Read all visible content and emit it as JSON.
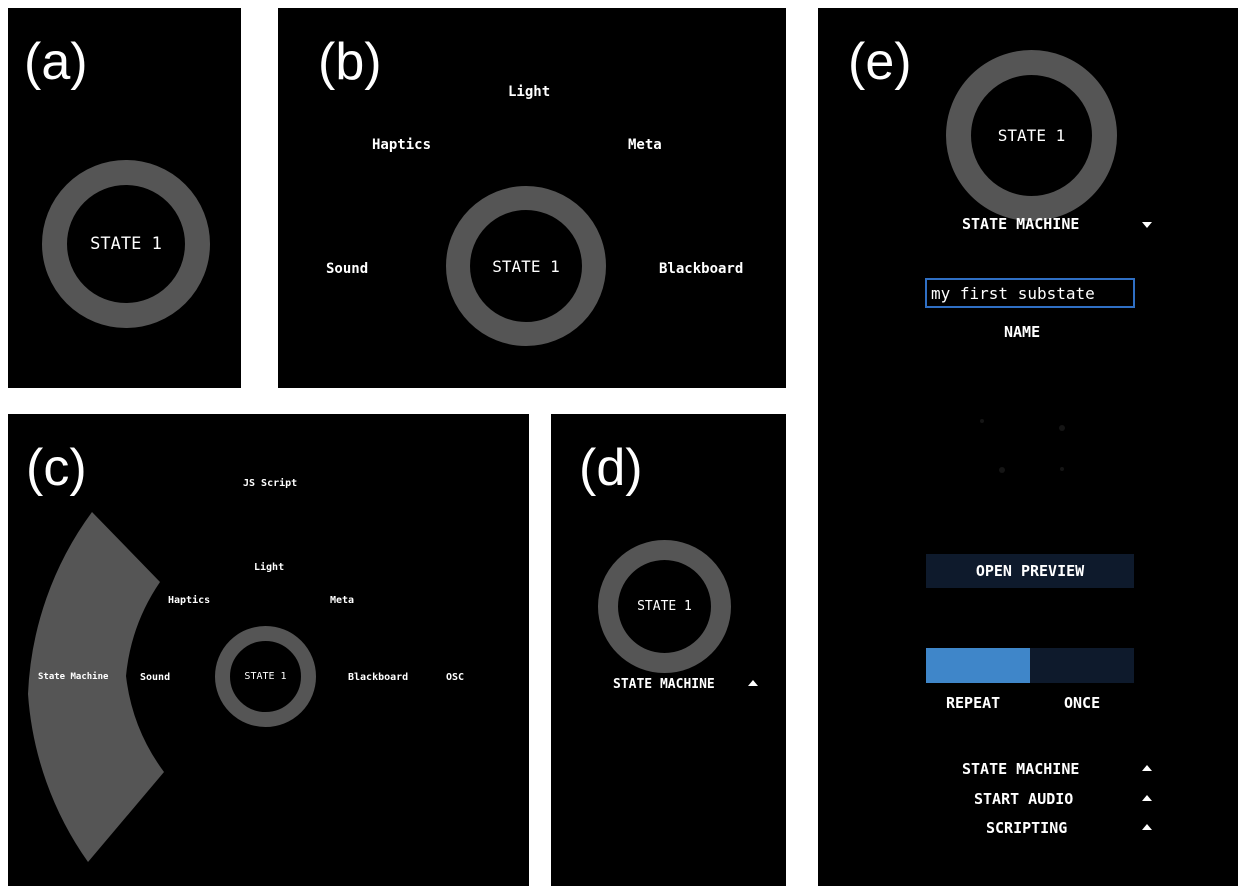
{
  "panels": {
    "a": {
      "label": "(a)",
      "state": "STATE 1"
    },
    "b": {
      "label": "(b)",
      "state": "STATE 1",
      "menu": {
        "light": "Light",
        "haptics": "Haptics",
        "meta": "Meta",
        "sound": "Sound",
        "blackboard": "Blackboard"
      }
    },
    "c": {
      "label": "(c)",
      "state": "STATE 1",
      "menu": {
        "js_script": "JS Script",
        "light": "Light",
        "haptics": "Haptics",
        "meta": "Meta",
        "state_machine": "State Machine",
        "sound": "Sound",
        "blackboard": "Blackboard",
        "osc": "OSC"
      }
    },
    "d": {
      "label": "(d)",
      "state": "STATE 1",
      "dropdown": "STATE MACHINE"
    },
    "e": {
      "label": "(e)",
      "state": "STATE 1",
      "dropdown": "STATE MACHINE",
      "name_value": "my first substate",
      "name_label": "NAME",
      "preview_button": "OPEN PREVIEW",
      "repeat": "REPEAT",
      "once": "ONCE",
      "repeat_selected_fraction": 0.5,
      "sections": [
        "STATE MACHINE",
        "START AUDIO",
        "SCRIPTING"
      ]
    }
  },
  "colors": {
    "panel_bg": "#000000",
    "ring": "#555555",
    "input_border": "#2f6fc4",
    "button_bg": "#0e1a2c",
    "toggle_on": "#3f86c9",
    "toggle_off": "#0e1a2c"
  }
}
